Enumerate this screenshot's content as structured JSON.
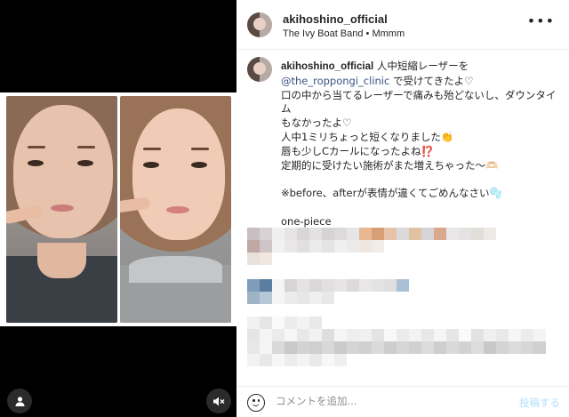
{
  "post": {
    "username": "akihoshino_official",
    "audio": "The Ivy Boat Band • Mmmm",
    "more_icon": "more-horizontal-icon"
  },
  "caption": {
    "username": "akihoshino_official",
    "line1": "人中短縮レーザーを",
    "mention1": "@the_roppongi_clinic",
    "line2_rest": " で受けてきたよ♡",
    "line3": "口の中から当てるレーザーで痛みも殆どないし、ダウンタイム",
    "line4": "もなかったよ♡",
    "line5": "人中1ミリちょっと短くなりました👏",
    "line6": "唇も少しCカールになったよね⁉️",
    "line7": "定期的に受けたい施術がまた増えちゃった〜🫶🏻",
    "line8": "※before、afterが表情が違くてごめんなさい🫧",
    "line9": "one-piece",
    "mention2": "@celford_official"
  },
  "footer": {
    "placeholder": "コメントを追加...",
    "post_label": "投稿する"
  },
  "media": {
    "user_icon": "user-icon",
    "mute_icon": "speaker-muted-icon"
  }
}
